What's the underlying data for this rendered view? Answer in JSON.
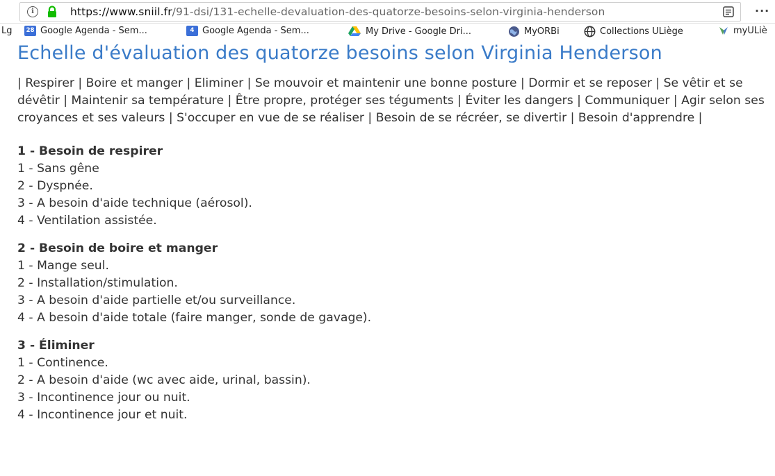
{
  "browser": {
    "url_host": "https://www.sniil.fr",
    "url_path": "/91-dsi/131-echelle-devaluation-des-quatorze-besoins-selon-virginia-henderson",
    "more_label": "···"
  },
  "bookmarks": [
    {
      "label": "Lg",
      "icon": "none"
    },
    {
      "label": "Google Agenda - Sem...",
      "icon": "calendar-icon",
      "badge": "28"
    },
    {
      "label": "Google Agenda - Sem...",
      "icon": "calendar-icon",
      "badge": "4"
    },
    {
      "label": "My Drive - Google Dri...",
      "icon": "drive-icon"
    },
    {
      "label": "MyORBi",
      "icon": "globe-icon"
    },
    {
      "label": "Collections ULiège",
      "icon": "globe-icon"
    },
    {
      "label": "myULiè",
      "icon": "leaf-icon"
    }
  ],
  "page": {
    "title": "Echelle d'évaluation des quatorze besoins selon Virginia Henderson",
    "nav_text": "| Respirer | Boire et manger | Eliminer | Se mouvoir et maintenir une bonne posture | Dormir et se reposer | Se vêtir et se dévêtir | Maintenir sa température | Être propre, protéger ses téguments | Éviter les dangers | Communiquer | Agir selon ses croyances et ses valeurs | S'occuper en vue de se réaliser | Besoin de se récréer, se divertir | Besoin d'apprendre |",
    "sections": [
      {
        "title": "1 - Besoin de respirer",
        "items": [
          "1 - Sans gêne",
          "2 - Dyspnée.",
          "3 - A besoin d'aide technique (aérosol).",
          "4 - Ventilation assistée."
        ]
      },
      {
        "title": "2 - Besoin de boire et manger",
        "items": [
          "1 - Mange seul.",
          "2 - Installation/stimulation.",
          "3 - A besoin d'aide partielle et/ou surveillance.",
          "4 - A besoin d'aide totale (faire manger, sonde de gavage)."
        ]
      },
      {
        "title": "3 - Éliminer",
        "items": [
          "1 - Continence.",
          "2 - A besoin d'aide (wc avec aide, urinal, bassin).",
          "3 - Incontinence jour ou nuit.",
          "4 - Incontinence jour et nuit."
        ]
      }
    ]
  }
}
